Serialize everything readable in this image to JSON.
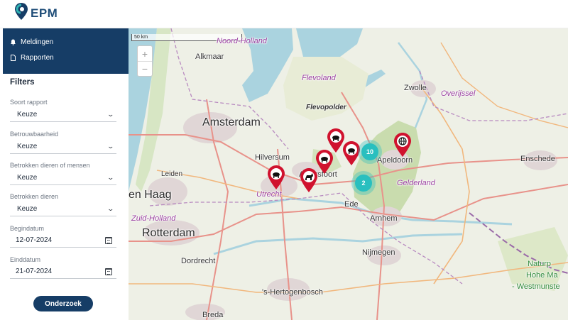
{
  "brand": {
    "name": "EPM",
    "accent": "#163d66",
    "logo_teal": "#2fb5b5"
  },
  "nav": {
    "items": [
      {
        "label": "Meldingen",
        "icon": "bell-icon"
      },
      {
        "label": "Rapporten",
        "icon": "document-icon"
      }
    ]
  },
  "filters": {
    "title": "Filters",
    "fields": [
      {
        "label": "Soort rapport",
        "value": "Keuze"
      },
      {
        "label": "Betrouwbaarheid",
        "value": "Keuze"
      },
      {
        "label": "Betrokken dieren of mensen",
        "value": "Keuze"
      },
      {
        "label": "Betrokken dieren",
        "value": "Keuze"
      }
    ],
    "start": {
      "label": "Begindatum",
      "value": "12-07-2024"
    },
    "end": {
      "label": "Einddatum",
      "value": "21-07-2024"
    },
    "submit_label": "Onderzoek"
  },
  "map": {
    "scale_label": "50 km",
    "zoom_in": "+",
    "zoom_out": "−",
    "places": {
      "noord_holland": "Noord-Holland",
      "alkmaar": "Alkmaar",
      "flevoland": "Flevoland",
      "zwolle": "Zwolle",
      "overijssel": "Overijssel",
      "flevopolder": "Flevopolder",
      "amsterdam": "Amsterdam",
      "hilversum": "Hilversum",
      "apeldoorn": "Apeldoorn",
      "enschede": "Enschede",
      "leiden": "Leiden",
      "den_haag": "en Haag",
      "amersfoort": "Amersfoort",
      "gelderland": "Gelderland",
      "utrecht": "Utrecht",
      "ede": "Ede",
      "zuid_holland": "Zuid-Holland",
      "arnhem": "Arnhem",
      "rotterdam": "Rotterdam",
      "nijmegen": "Nijmegen",
      "dordrecht": "Dordrecht",
      "natura": "Naturp",
      "hohe_mark": "Hohe Ma",
      "westmunster": "- Westmunste",
      "den_bosch": "'s-Hertogenbosch",
      "breda": "Breda"
    },
    "clusters": [
      {
        "count": "10"
      },
      {
        "count": "2"
      }
    ],
    "colors": {
      "pin": "#d0122e",
      "cluster": "#29bfbf"
    }
  }
}
